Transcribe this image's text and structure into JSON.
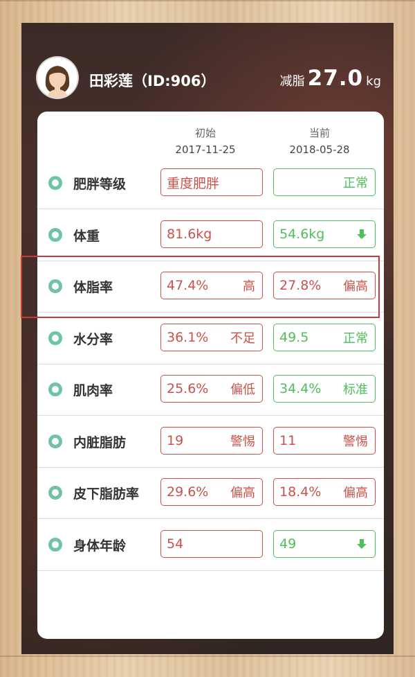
{
  "user": {
    "name_id": "田彩莲（ID:906）"
  },
  "fat_loss": {
    "prefix": "减脂",
    "value": "27.0",
    "unit": "kg"
  },
  "columns": [
    {
      "label": "初始",
      "date": "2017-11-25"
    },
    {
      "label": "当前",
      "date": "2018-05-28"
    }
  ],
  "colors": {
    "accent_teal": "#6fc3a9",
    "warn_red": "#c9524a",
    "ok_green": "#4fbe5b",
    "highlight_red": "#c63b3b"
  },
  "rows": [
    {
      "label": "肥胖等级",
      "initial": {
        "value": "重度肥胖",
        "tag": "",
        "tone": "red"
      },
      "current": {
        "value": "",
        "tag": "正常",
        "tone": "green"
      }
    },
    {
      "label": "体重",
      "initial": {
        "value": "81.6kg",
        "tag": "",
        "tone": "red"
      },
      "current": {
        "value": "54.6kg",
        "tag": "",
        "tone": "green",
        "icon": "arrow-down-icon"
      }
    },
    {
      "label": "体脂率",
      "initial": {
        "value": "47.4%",
        "tag": "高",
        "tone": "red"
      },
      "current": {
        "value": "27.8%",
        "tag": "偏高",
        "tone": "red"
      }
    },
    {
      "label": "水分率",
      "initial": {
        "value": "36.1%",
        "tag": "不足",
        "tone": "red"
      },
      "current": {
        "value": "49.5",
        "tag": "正常",
        "tone": "green"
      }
    },
    {
      "label": "肌肉率",
      "initial": {
        "value": "25.6%",
        "tag": "偏低",
        "tone": "red"
      },
      "current": {
        "value": "34.4%",
        "tag": "标准",
        "tone": "green"
      }
    },
    {
      "label": "内脏脂肪",
      "initial": {
        "value": "19",
        "tag": "警惕",
        "tone": "red"
      },
      "current": {
        "value": "11",
        "tag": "警惕",
        "tone": "red"
      }
    },
    {
      "label": "皮下脂肪率",
      "initial": {
        "value": "29.6%",
        "tag": "偏高",
        "tone": "red"
      },
      "current": {
        "value": "18.4%",
        "tag": "偏高",
        "tone": "red"
      }
    },
    {
      "label": "身体年龄",
      "initial": {
        "value": "54",
        "tag": "",
        "tone": "red"
      },
      "current": {
        "value": "49",
        "tag": "",
        "tone": "green",
        "icon": "arrow-down-icon"
      }
    }
  ]
}
